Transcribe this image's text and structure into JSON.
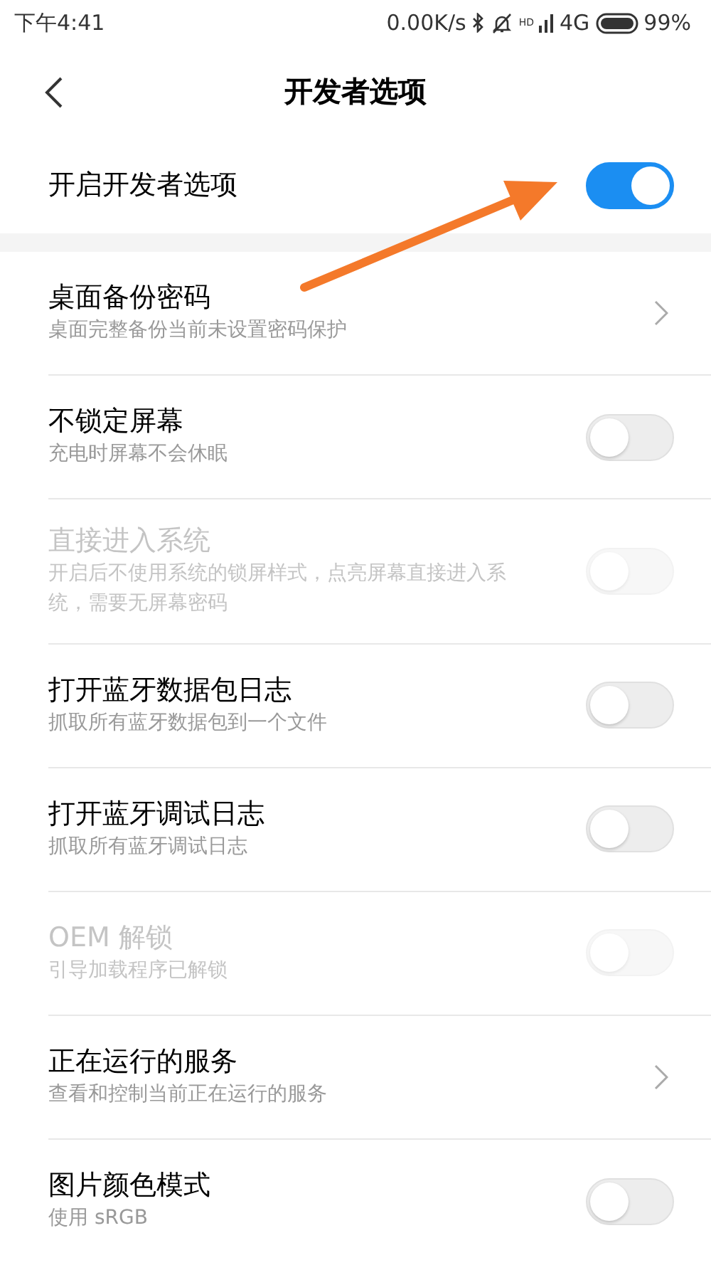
{
  "status_bar": {
    "time": "下午4:41",
    "speed": "0.00K/s",
    "hd": "HD",
    "network": "4G",
    "battery": "99%"
  },
  "header": {
    "title": "开发者选项"
  },
  "master": {
    "title": "开启开发者选项",
    "on": true
  },
  "items": [
    {
      "kind": "link",
      "title": "桌面备份密码",
      "subtitle": "桌面完整备份当前未设置密码保护",
      "disabled": false
    },
    {
      "kind": "toggle",
      "title": "不锁定屏幕",
      "subtitle": "充电时屏幕不会休眠",
      "disabled": false,
      "on": false
    },
    {
      "kind": "toggle",
      "title": "直接进入系统",
      "subtitle": "开启后不使用系统的锁屏样式，点亮屏幕直接进入系统，需要无屏幕密码",
      "disabled": true,
      "on": false
    },
    {
      "kind": "toggle",
      "title": "打开蓝牙数据包日志",
      "subtitle": "抓取所有蓝牙数据包到一个文件",
      "disabled": false,
      "on": false
    },
    {
      "kind": "toggle",
      "title": "打开蓝牙调试日志",
      "subtitle": "抓取所有蓝牙调试日志",
      "disabled": false,
      "on": false
    },
    {
      "kind": "toggle",
      "title": "OEM 解锁",
      "subtitle": "引导加载程序已解锁",
      "disabled": true,
      "on": false
    },
    {
      "kind": "link",
      "title": "正在运行的服务",
      "subtitle": "查看和控制当前正在运行的服务",
      "disabled": false
    },
    {
      "kind": "toggle",
      "title": "图片颜色模式",
      "subtitle": "使用 sRGB",
      "disabled": false,
      "on": false
    }
  ]
}
